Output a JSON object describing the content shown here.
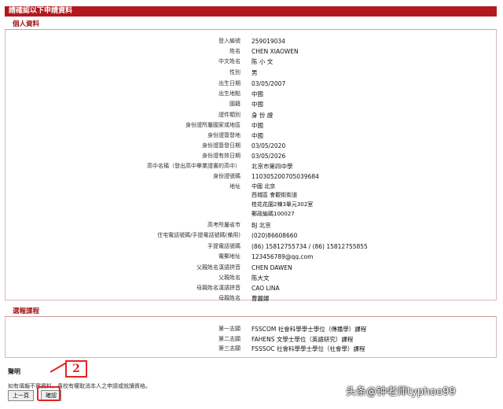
{
  "header": {
    "title": "請確認以下申請資料"
  },
  "personal": {
    "section_title": "個人資料",
    "fields": [
      {
        "label": "登入編號",
        "value": "259019034"
      },
      {
        "label": "姓名",
        "value": "CHEN XIAOWEN"
      },
      {
        "label": "中文姓名",
        "value": "陈 小 文"
      },
      {
        "label": "性別",
        "value": "男"
      },
      {
        "label": "出生日期",
        "value": "03/05/2007"
      },
      {
        "label": "出生地點",
        "value": "中國"
      },
      {
        "label": "國籍",
        "value": "中國"
      },
      {
        "label": "證件類別",
        "value": "身 份 證"
      },
      {
        "label": "身份證所屬國家或地區",
        "value": "中國"
      },
      {
        "label": "身份證簽發地",
        "value": "中國"
      },
      {
        "label": "身份證簽發日期",
        "value": "03/05/2020"
      },
      {
        "label": "身份證有效日期",
        "value": "03/05/2026"
      },
      {
        "label": "高中名稱（發出高中畢業證書的高中）",
        "value": "北京市第四中學"
      },
      {
        "label": "身份證號碼",
        "value": "110305200705039684"
      }
    ],
    "address": {
      "label": "地址",
      "lines": [
        "中國 北京",
        "西城區 會觀街街道",
        "桂花花園2棟3單元302室",
        "郵政編碼100027"
      ]
    },
    "fields2": [
      {
        "label": "高考所屬省市",
        "value": "BJ 北京"
      },
      {
        "label": "住宅電話號碼/手提電話號碼(備用)",
        "value": "(020)86608660"
      },
      {
        "label": "手提電話號碼",
        "value": "(86) 15812755734 / (86) 15812755855"
      },
      {
        "label": "電郵地址",
        "value": "123456789@qq.com"
      },
      {
        "label": "父親姓名漢語拼音",
        "value": "CHEN DAWEN"
      },
      {
        "label": "父親姓名",
        "value": "陈大文"
      },
      {
        "label": "母親姓名漢語拼音",
        "value": "CAO LINA"
      },
      {
        "label": "母親姓名",
        "value": "曹麗娜"
      }
    ]
  },
  "courses": {
    "section_title": "選報課程",
    "items": [
      {
        "label": "第一志願",
        "value": "FSSCOM 社會科學學士學位（傳播學）課程"
      },
      {
        "label": "第二志願",
        "value": "FAHENS 文學士學位（英語研究）課程"
      },
      {
        "label": "第三志願",
        "value": "FSSSOC 社會科學學士學位（社會學）課程"
      }
    ]
  },
  "declaration": {
    "title": "聲明",
    "text": "如有填報不實資料，貴校有權取消本人之申請或就讀資格。"
  },
  "buttons": {
    "prev": "上一頁",
    "confirm": "確認"
  },
  "annotation": {
    "step": "2"
  },
  "watermark": "头条@钟老师typhoo99",
  "colors": {
    "accent": "#b3181d",
    "highlight": "#e12424"
  }
}
